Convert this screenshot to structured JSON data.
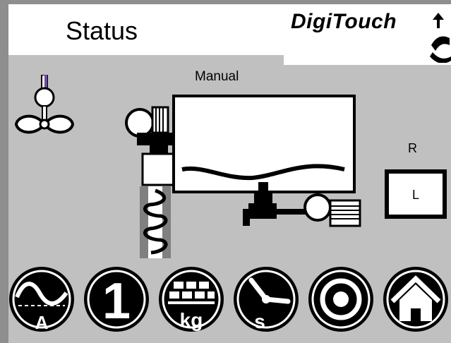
{
  "header": {
    "title": "Status",
    "logo_text": "DigiTouch"
  },
  "machine": {
    "mode": "Manual"
  },
  "side_panel": {
    "r_label": "R",
    "l_label": "L"
  },
  "buttons": [
    {
      "name": "ampere-button",
      "label": "A"
    },
    {
      "name": "counter-button",
      "label": "1"
    },
    {
      "name": "weight-button",
      "label": "kg"
    },
    {
      "name": "time-button",
      "label": "s"
    },
    {
      "name": "target-button",
      "label": ""
    },
    {
      "name": "home-button",
      "label": ""
    }
  ],
  "colors": {
    "background": "#c0c0c0",
    "foreground": "#000000",
    "panel": "#ffffff"
  }
}
